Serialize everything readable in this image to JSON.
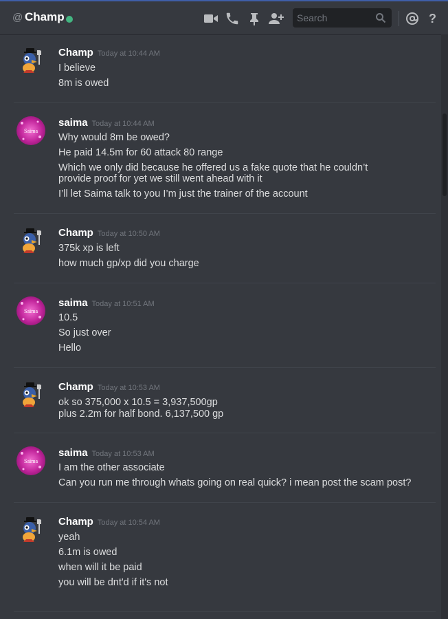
{
  "header": {
    "at_symbol": "@",
    "channel_name": "Champ",
    "status_color": "#43b581",
    "search_placeholder": "Search",
    "icons": [
      "video-call-icon",
      "voice-call-icon",
      "pin-icon",
      "add-friend-icon",
      "search-icon",
      "mention-icon",
      "help-icon"
    ]
  },
  "messages": [
    {
      "author": "Champ",
      "timestamp": "Today at 10:44 AM",
      "avatar": "champ-bird-avatar",
      "lines": [
        "I believe",
        "8m is owed"
      ]
    },
    {
      "author": "saima",
      "timestamp": "Today at 10:44 AM",
      "avatar": "saima-avatar",
      "avatar_text": "Saima",
      "lines": [
        "Why would 8m be owed?",
        "He paid 14.5m for 60 attack 80 range",
        "Which we only did because he offered us a fake quote that he couldn’t provide proof for yet we still went ahead with it",
        "I’ll let Saima talk to you I’m just the trainer of the account"
      ]
    },
    {
      "author": "Champ",
      "timestamp": "Today at 10:50 AM",
      "avatar": "champ-bird-avatar",
      "lines": [
        "375k xp is left",
        "how much gp/xp did you charge"
      ]
    },
    {
      "author": "saima",
      "timestamp": "Today at 10:51 AM",
      "avatar": "saima-avatar",
      "avatar_text": "Saima",
      "lines": [
        "10.5",
        "So just over",
        "Hello"
      ]
    },
    {
      "author": "Champ",
      "timestamp": "Today at 10:53 AM",
      "avatar": "champ-bird-avatar",
      "lines": [
        "ok so 375,000 x 10.5 = 3,937,500gp",
        "plus 2.2m for half bond. 6,137,500 gp"
      ]
    },
    {
      "author": "saima",
      "timestamp": "Today at 10:53 AM",
      "avatar": "saima-avatar",
      "avatar_text": "Saima",
      "lines": [
        "I am the other associate",
        "Can you run me through whats going on real quick? i mean post the scam post?"
      ]
    },
    {
      "author": "Champ",
      "timestamp": "Today at 10:54 AM",
      "avatar": "champ-bird-avatar",
      "lines": [
        "yeah",
        "6.1m is owed",
        "when will it be paid",
        "you will be dnt'd if it's not"
      ]
    }
  ]
}
